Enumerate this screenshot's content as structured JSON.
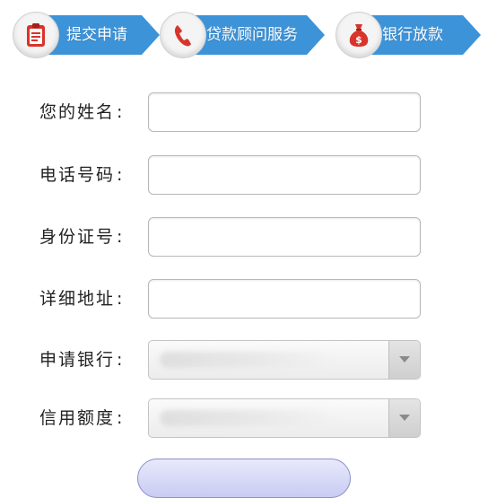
{
  "steps": [
    {
      "label": "提交申请",
      "icon": "clipboard-icon"
    },
    {
      "label": "贷款顾问服务",
      "icon": "phone-icon"
    },
    {
      "label": "银行放款",
      "icon": "money-bag-icon"
    }
  ],
  "form": {
    "name_label": "您的姓名",
    "phone_label": "电话号码",
    "id_label": "身份证号",
    "address_label": "详细地址",
    "bank_label": "申请银行",
    "amount_label": "信用额度",
    "colon": ":",
    "name_value": "",
    "phone_value": "",
    "id_value": "",
    "address_value": ""
  },
  "colors": {
    "accent": "#3d93d8",
    "step_icon_red": "#d9342b",
    "button_fill": "#c9cbf3"
  }
}
